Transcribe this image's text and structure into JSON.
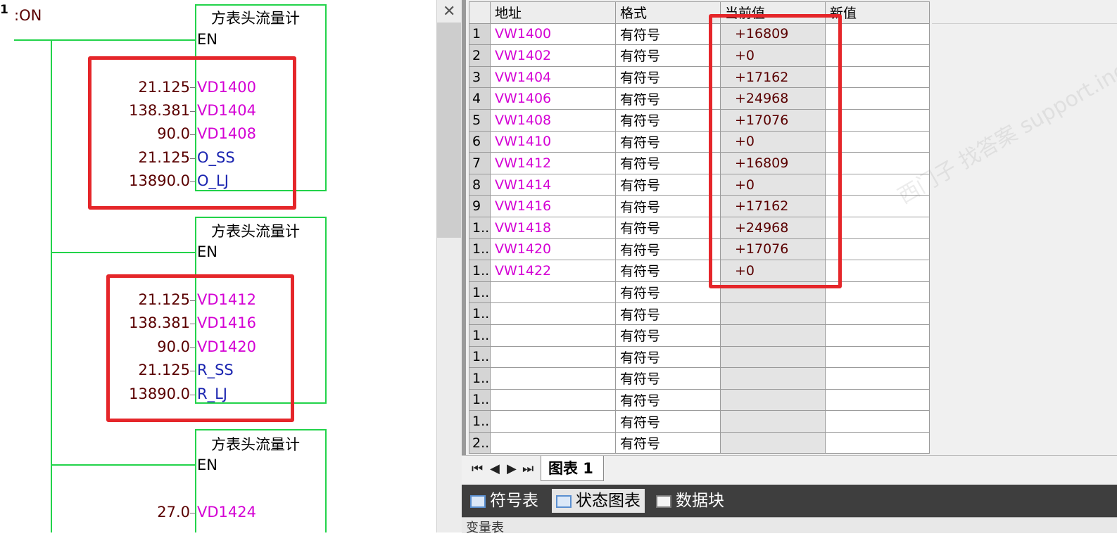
{
  "ladder": {
    "rung_number": "1",
    "contact_label": ":ON",
    "blocks": [
      {
        "title": "方表头流量计",
        "en": "EN",
        "params": [
          {
            "value": "21.125",
            "name": "VD1400",
            "kind": "v"
          },
          {
            "value": "138.381",
            "name": "VD1404",
            "kind": "v"
          },
          {
            "value": "90.0",
            "name": "VD1408",
            "kind": "v"
          },
          {
            "value": "21.125",
            "name": "O_SS",
            "kind": "s"
          },
          {
            "value": "13890.0",
            "name": "O_LJ",
            "kind": "s"
          }
        ]
      },
      {
        "title": "方表头流量计",
        "en": "EN",
        "params": [
          {
            "value": "21.125",
            "name": "VD1412",
            "kind": "v"
          },
          {
            "value": "138.381",
            "name": "VD1416",
            "kind": "v"
          },
          {
            "value": "90.0",
            "name": "VD1420",
            "kind": "v"
          },
          {
            "value": "21.125",
            "name": "R_SS",
            "kind": "s"
          },
          {
            "value": "13890.0",
            "name": "R_LJ",
            "kind": "s"
          }
        ]
      },
      {
        "title": "方表头流量计",
        "en": "EN",
        "params": [
          {
            "value": "27.0",
            "name": "VD1424",
            "kind": "v"
          }
        ]
      }
    ]
  },
  "status_chart": {
    "headers": [
      "",
      "地址",
      "格式",
      "当前值",
      "新值"
    ],
    "rows": [
      {
        "num": "1",
        "address": "VW1400",
        "format": "有符号",
        "current": "+16809",
        "new": ""
      },
      {
        "num": "2",
        "address": "VW1402",
        "format": "有符号",
        "current": "+0",
        "new": ""
      },
      {
        "num": "3",
        "address": "VW1404",
        "format": "有符号",
        "current": "+17162",
        "new": ""
      },
      {
        "num": "4",
        "address": "VW1406",
        "format": "有符号",
        "current": "+24968",
        "new": ""
      },
      {
        "num": "5",
        "address": "VW1408",
        "format": "有符号",
        "current": "+17076",
        "new": ""
      },
      {
        "num": "6",
        "address": "VW1410",
        "format": "有符号",
        "current": "+0",
        "new": ""
      },
      {
        "num": "7",
        "address": "VW1412",
        "format": "有符号",
        "current": "+16809",
        "new": ""
      },
      {
        "num": "8",
        "address": "VW1414",
        "format": "有符号",
        "current": "+0",
        "new": ""
      },
      {
        "num": "9",
        "address": "VW1416",
        "format": "有符号",
        "current": "+17162",
        "new": ""
      },
      {
        "num": "1..",
        "address": "VW1418",
        "format": "有符号",
        "current": "+24968",
        "new": ""
      },
      {
        "num": "1..",
        "address": "VW1420",
        "format": "有符号",
        "current": "+17076",
        "new": ""
      },
      {
        "num": "1..",
        "address": "VW1422",
        "format": "有符号",
        "current": "+0",
        "new": ""
      },
      {
        "num": "1..",
        "address": "",
        "format": "有符号",
        "current": "",
        "new": ""
      },
      {
        "num": "1..",
        "address": "",
        "format": "有符号",
        "current": "",
        "new": ""
      },
      {
        "num": "1..",
        "address": "",
        "format": "有符号",
        "current": "",
        "new": ""
      },
      {
        "num": "1..",
        "address": "",
        "format": "有符号",
        "current": "",
        "new": ""
      },
      {
        "num": "1..",
        "address": "",
        "format": "有符号",
        "current": "",
        "new": ""
      },
      {
        "num": "1..",
        "address": "",
        "format": "有符号",
        "current": "",
        "new": ""
      },
      {
        "num": "1..",
        "address": "",
        "format": "有符号",
        "current": "",
        "new": ""
      },
      {
        "num": "2..",
        "address": "",
        "format": "有符号",
        "current": "",
        "new": ""
      }
    ],
    "sheet_tab": "图表 1",
    "nav_buttons": [
      "first-icon",
      "prev-icon",
      "next-icon",
      "last-icon"
    ]
  },
  "bottom_tabs": [
    {
      "label": "符号表",
      "icon": "symbol-table-icon"
    },
    {
      "label": "状态图表",
      "icon": "status-chart-icon"
    },
    {
      "label": "数据块",
      "icon": "data-block-icon"
    }
  ],
  "status_strip_text": "变量表",
  "watermark_text": "西门子 找答案 support.industry.siemens.com/cs",
  "colors": {
    "highlight_red": "#e5262a",
    "wire_green": "#22d34a",
    "address_magenta": "#d400d4",
    "symbol_blue": "#1a24b0",
    "value_darkred": "#5a0000"
  }
}
